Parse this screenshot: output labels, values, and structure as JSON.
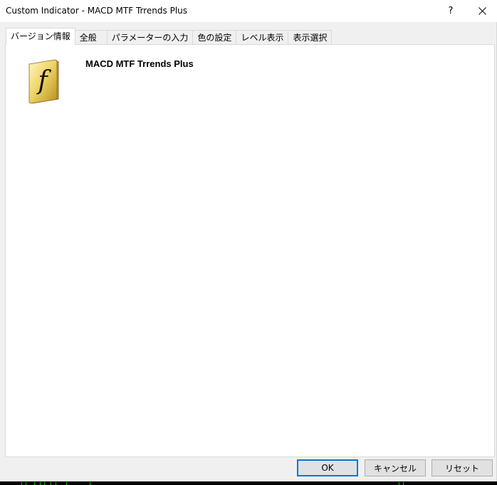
{
  "window": {
    "title": "Custom Indicator - MACD MTF Trrends Plus",
    "help_label": "?",
    "close_icon": "close-icon"
  },
  "tabs": [
    {
      "label": "バージョン情報",
      "active": true
    },
    {
      "label": "全般",
      "active": false
    },
    {
      "label": "パラメーターの入力",
      "active": false
    },
    {
      "label": "色の設定",
      "active": false
    },
    {
      "label": "レベル表示",
      "active": false
    },
    {
      "label": "表示選択",
      "active": false
    }
  ],
  "about": {
    "icon": "indicator-function-icon",
    "icon_glyph": "f",
    "name": "MACD MTF Trrends Plus"
  },
  "buttons": {
    "ok": "OK",
    "cancel": "キャンセル",
    "reset": "リセット"
  },
  "colors": {
    "accent": "#0078d7",
    "icon_gold": "#e8c84a",
    "chart_tick": "#00c000"
  }
}
